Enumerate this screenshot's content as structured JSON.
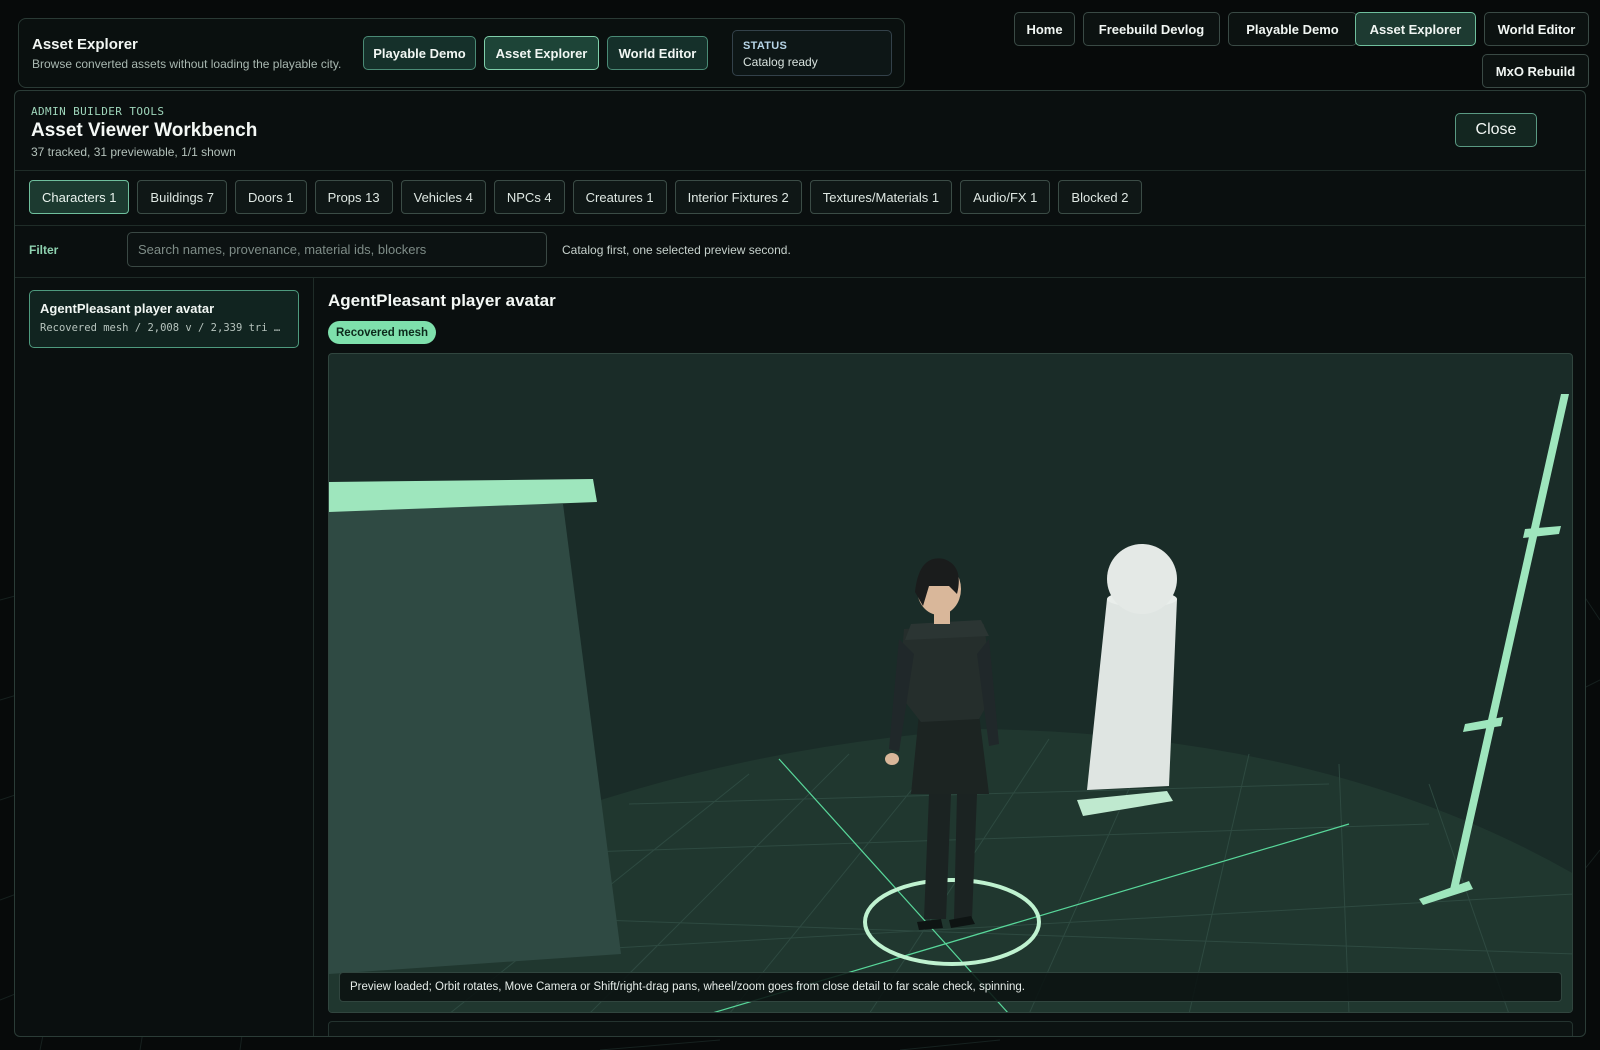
{
  "header": {
    "title": "Asset Explorer",
    "subtitle": "Browse converted assets without loading the playable city.",
    "buttons": [
      "Playable Demo",
      "Asset Explorer",
      "World Editor"
    ],
    "status_label": "STATUS",
    "status_value": "Catalog ready"
  },
  "nav": {
    "items": [
      "Home",
      "Freebuild Devlog",
      "Playable Demo",
      "Asset Explorer",
      "World Editor",
      "MxO Rebuild"
    ],
    "active": "Asset Explorer"
  },
  "workbench": {
    "kicker": "ADMIN BUILDER TOOLS",
    "title": "Asset Viewer Workbench",
    "counts": "37 tracked, 31 previewable, 1/1 shown",
    "close_label": "Close"
  },
  "categories": [
    "Characters 1",
    "Buildings 7",
    "Doors 1",
    "Props 13",
    "Vehicles 4",
    "NPCs 4",
    "Creatures 1",
    "Interior Fixtures 2",
    "Textures/Materials 1",
    "Audio/FX 1",
    "Blocked 2"
  ],
  "active_category": "Characters 1",
  "filter": {
    "label": "Filter",
    "placeholder": "Search names, provenance, material ids, blockers",
    "value": "",
    "hint": "Catalog first, one selected preview second."
  },
  "asset_list": [
    {
      "name": "AgentPleasant player avatar",
      "meta": "Recovered mesh / 2,008 v / 2,339 tri …"
    }
  ],
  "preview": {
    "title": "AgentPleasant player avatar",
    "badge": "Recovered mesh",
    "status": "Preview loaded; Orbit rotates, Move Camera or Shift/right-drag pans, wheel/zoom goes from close detail to far scale check, spinning."
  },
  "colors": {
    "accent": "#7ee0ac",
    "background": "#070a0a",
    "panel": "#0a0f0f",
    "viewport": "#1a2c28"
  }
}
